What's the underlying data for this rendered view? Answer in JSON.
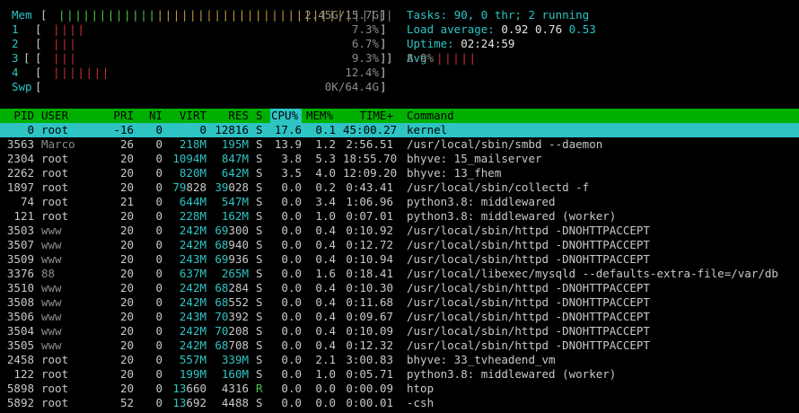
{
  "meters": {
    "mem": {
      "label": "Mem",
      "value": "2.45G/15.7G",
      "fill_fraction": 0.156
    },
    "cpus": [
      {
        "label": "1",
        "value": "7.3%",
        "fill_fraction": 0.073
      },
      {
        "label": "2",
        "value": "6.7%",
        "fill_fraction": 0.067
      },
      {
        "label": "3",
        "value": "9.3%",
        "fill_fraction": 0.093
      },
      {
        "label": "4",
        "value": "12.4%",
        "fill_fraction": 0.124
      }
    ],
    "swp": {
      "label": "Swp",
      "value": "0K/64.4G",
      "fill_fraction": 0.0
    },
    "avg": {
      "label": "Avg",
      "value": "8.9%",
      "fill_fraction": 0.089
    }
  },
  "summary": {
    "tasks_label": "Tasks: ",
    "tasks_value": "90, 0 thr; 2 running",
    "load_label": "Load average: ",
    "load_1": "0.92",
    "load_5": "0.76",
    "load_15": "0.53",
    "uptime_label": "Uptime: ",
    "uptime_value": "02:24:59"
  },
  "columns": {
    "pid": "PID",
    "user": "USER",
    "pri": "PRI",
    "ni": "NI",
    "virt": "VIRT",
    "res": "RES",
    "s": "S",
    "cpu": "CPU%",
    "mem": "MEM%",
    "time": "TIME+",
    "command": "Command"
  },
  "processes": [
    {
      "pid": "0",
      "user": "root",
      "pri": "-16",
      "ni": "0",
      "virt": "0",
      "res": "12816",
      "s": "S",
      "cpu": "17.6",
      "mem": "0.1",
      "time": "45:00.27",
      "command": "kernel",
      "selected": true
    },
    {
      "pid": "3563",
      "user": "Marco",
      "pri": "26",
      "ni": "0",
      "virt": "218M",
      "res": "195M",
      "s": "S",
      "cpu": "13.9",
      "mem": "1.2",
      "time": "2:56.51",
      "command": "/usr/local/sbin/smbd --daemon"
    },
    {
      "pid": "2304",
      "user": "root",
      "pri": "20",
      "ni": "0",
      "virt": "1094M",
      "res": "847M",
      "s": "S",
      "cpu": "3.8",
      "mem": "5.3",
      "time": "18:55.70",
      "command": "bhyve: 15_mailserver"
    },
    {
      "pid": "2262",
      "user": "root",
      "pri": "20",
      "ni": "0",
      "virt": "820M",
      "res": "642M",
      "s": "S",
      "cpu": "3.5",
      "mem": "4.0",
      "time": "12:09.20",
      "command": "bhyve: 13_fhem"
    },
    {
      "pid": "1897",
      "user": "root",
      "pri": "20",
      "ni": "0",
      "virt": "79828",
      "res": "39028",
      "s": "S",
      "cpu": "0.0",
      "mem": "0.2",
      "time": "0:43.41",
      "command": "/usr/local/sbin/collectd -f"
    },
    {
      "pid": "74",
      "user": "root",
      "pri": "21",
      "ni": "0",
      "virt": "644M",
      "res": "547M",
      "s": "S",
      "cpu": "0.0",
      "mem": "3.4",
      "time": "1:06.96",
      "command": "python3.8: middlewared"
    },
    {
      "pid": "121",
      "user": "root",
      "pri": "20",
      "ni": "0",
      "virt": "228M",
      "res": "162M",
      "s": "S",
      "cpu": "0.0",
      "mem": "1.0",
      "time": "0:07.01",
      "command": "python3.8: middlewared (worker)"
    },
    {
      "pid": "3503",
      "user": "www",
      "pri": "20",
      "ni": "0",
      "virt": "242M",
      "res": "69300",
      "s": "S",
      "cpu": "0.0",
      "mem": "0.4",
      "time": "0:10.92",
      "command": "/usr/local/sbin/httpd -DNOHTTPACCEPT"
    },
    {
      "pid": "3507",
      "user": "www",
      "pri": "20",
      "ni": "0",
      "virt": "242M",
      "res": "68940",
      "s": "S",
      "cpu": "0.0",
      "mem": "0.4",
      "time": "0:12.72",
      "command": "/usr/local/sbin/httpd -DNOHTTPACCEPT"
    },
    {
      "pid": "3509",
      "user": "www",
      "pri": "20",
      "ni": "0",
      "virt": "243M",
      "res": "69936",
      "s": "S",
      "cpu": "0.0",
      "mem": "0.4",
      "time": "0:10.94",
      "command": "/usr/local/sbin/httpd -DNOHTTPACCEPT"
    },
    {
      "pid": "3376",
      "user": "88",
      "pri": "20",
      "ni": "0",
      "virt": "637M",
      "res": "265M",
      "s": "S",
      "cpu": "0.0",
      "mem": "1.6",
      "time": "0:18.41",
      "command": "/usr/local/libexec/mysqld --defaults-extra-file=/var/db"
    },
    {
      "pid": "3510",
      "user": "www",
      "pri": "20",
      "ni": "0",
      "virt": "242M",
      "res": "68284",
      "s": "S",
      "cpu": "0.0",
      "mem": "0.4",
      "time": "0:10.30",
      "command": "/usr/local/sbin/httpd -DNOHTTPACCEPT"
    },
    {
      "pid": "3508",
      "user": "www",
      "pri": "20",
      "ni": "0",
      "virt": "242M",
      "res": "68552",
      "s": "S",
      "cpu": "0.0",
      "mem": "0.4",
      "time": "0:11.68",
      "command": "/usr/local/sbin/httpd -DNOHTTPACCEPT"
    },
    {
      "pid": "3506",
      "user": "www",
      "pri": "20",
      "ni": "0",
      "virt": "243M",
      "res": "70392",
      "s": "S",
      "cpu": "0.0",
      "mem": "0.4",
      "time": "0:09.67",
      "command": "/usr/local/sbin/httpd -DNOHTTPACCEPT"
    },
    {
      "pid": "3504",
      "user": "www",
      "pri": "20",
      "ni": "0",
      "virt": "242M",
      "res": "70208",
      "s": "S",
      "cpu": "0.0",
      "mem": "0.4",
      "time": "0:10.09",
      "command": "/usr/local/sbin/httpd -DNOHTTPACCEPT"
    },
    {
      "pid": "3505",
      "user": "www",
      "pri": "20",
      "ni": "0",
      "virt": "242M",
      "res": "68708",
      "s": "S",
      "cpu": "0.0",
      "mem": "0.4",
      "time": "0:12.32",
      "command": "/usr/local/sbin/httpd -DNOHTTPACCEPT"
    },
    {
      "pid": "2458",
      "user": "root",
      "pri": "20",
      "ni": "0",
      "virt": "557M",
      "res": "339M",
      "s": "S",
      "cpu": "0.0",
      "mem": "2.1",
      "time": "3:00.83",
      "command": "bhyve: 33_tvheadend_vm"
    },
    {
      "pid": "122",
      "user": "root",
      "pri": "20",
      "ni": "0",
      "virt": "199M",
      "res": "160M",
      "s": "S",
      "cpu": "0.0",
      "mem": "1.0",
      "time": "0:05.71",
      "command": "python3.8: middlewared (worker)"
    },
    {
      "pid": "5898",
      "user": "root",
      "pri": "20",
      "ni": "0",
      "virt": "13660",
      "res": "4316",
      "s": "R",
      "cpu": "0.0",
      "mem": "0.0",
      "time": "0:00.09",
      "command": "htop"
    },
    {
      "pid": "5892",
      "user": "root",
      "pri": "52",
      "ni": "0",
      "virt": "13692",
      "res": "4488",
      "s": "S",
      "cpu": "0.0",
      "mem": "0.0",
      "time": "0:00.01",
      "command": "-csh"
    }
  ],
  "colors": {
    "background": "#000000",
    "header_bg": "#00b000",
    "selection_bg": "#2ec4c4",
    "cyan": "#2ec4c4",
    "green": "#4ec94e",
    "red": "#d03030",
    "yellow": "#c8a030"
  }
}
